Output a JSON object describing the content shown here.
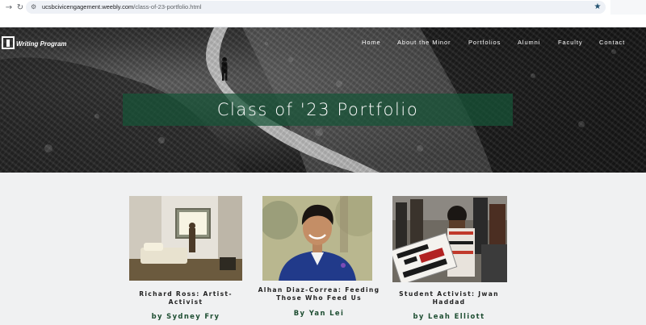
{
  "browser": {
    "url_domain": "ucsbcivicengagement.weebly.com",
    "url_path": "/class-of-23-portfolio.html",
    "back_icon": "arrow-right-icon",
    "reload_icon": "reload-icon",
    "bookmark_icon": "star-icon"
  },
  "site": {
    "logo_text": "Writing Program",
    "nav": [
      {
        "label": "Home"
      },
      {
        "label": "About the Minor"
      },
      {
        "label": "Portfolios"
      },
      {
        "label": "Alumni"
      },
      {
        "label": "Faculty"
      },
      {
        "label": "Contact"
      }
    ]
  },
  "hero": {
    "title": "Class of '23 Portfolio",
    "banner_color": "#165438"
  },
  "cards": [
    {
      "title": "Richard Ross: Artist-Activist",
      "author": "by Sydney Fry"
    },
    {
      "title": "Alhan Diaz-Correa: Feeding Those Who Feed Us",
      "author": "By Yan Lei"
    },
    {
      "title": "Student Activist: Jwan Haddad",
      "author": "by Leah Elliott"
    }
  ],
  "colors": {
    "author_text": "#1d4d31",
    "page_bg": "#f0f1f2"
  }
}
